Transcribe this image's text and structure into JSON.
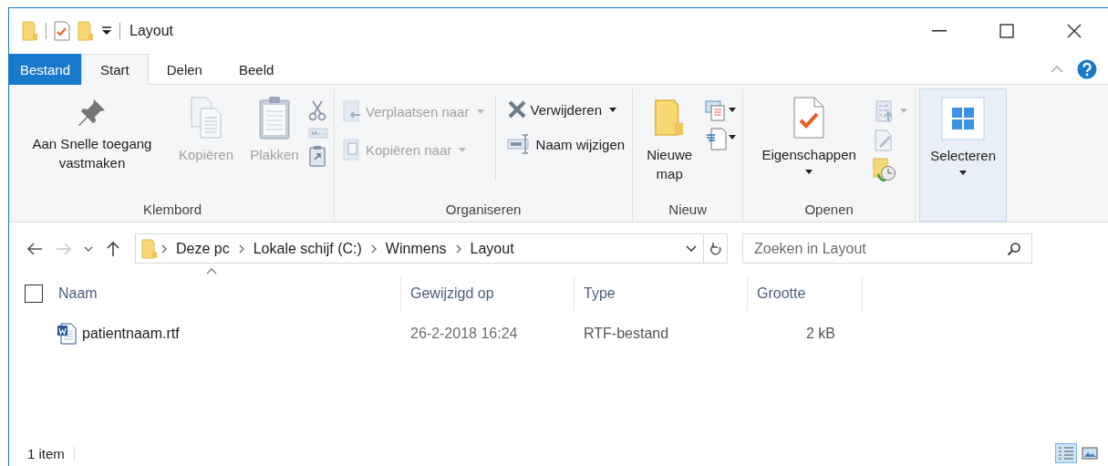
{
  "window": {
    "title": "Layout"
  },
  "ribbon_tabs": [
    {
      "label": "Bestand",
      "kind": "file",
      "selected": false
    },
    {
      "label": "Start",
      "kind": "tab",
      "selected": true
    },
    {
      "label": "Delen",
      "kind": "tab",
      "selected": false
    },
    {
      "label": "Beeld",
      "kind": "tab",
      "selected": false
    }
  ],
  "ribbon_groups": [
    {
      "label": "Klembord",
      "buttons": [
        {
          "label": "Aan Snelle toegang vastmaken",
          "disabled": false
        },
        {
          "label": "Kopiëren",
          "disabled": true
        },
        {
          "label": "Plakken",
          "disabled": true
        }
      ]
    },
    {
      "label": "Organiseren",
      "buttons": [
        {
          "label": "Verplaatsen naar",
          "disabled": true
        },
        {
          "label": "Kopiëren naar",
          "disabled": true
        },
        {
          "label": "Verwijderen",
          "disabled": false
        },
        {
          "label": "Naam wijzigen",
          "disabled": false
        }
      ]
    },
    {
      "label": "Nieuw",
      "buttons": [
        {
          "label": "Nieuwe map",
          "disabled": false
        }
      ]
    },
    {
      "label": "Openen",
      "buttons": [
        {
          "label": "Eigenschappen",
          "disabled": false
        }
      ]
    },
    {
      "buttons": [
        {
          "label": "Selecteren",
          "disabled": false
        }
      ]
    }
  ],
  "address_bar": {
    "crumbs": [
      "Deze pc",
      "Lokale schijf (C:)",
      "Winmens",
      "Layout"
    ]
  },
  "search": {
    "placeholder": "Zoeken in Layout"
  },
  "table": {
    "select_all": {
      "checked": false
    },
    "columns": [
      "Naam",
      "Gewijzigd op",
      "Type",
      "Grootte"
    ],
    "rows": [
      {
        "name": "patientnaam.rtf",
        "modified": "26-2-2018 16:24",
        "type": "RTF-bestand",
        "size": "2 kB"
      }
    ]
  },
  "status_bar": {
    "text": "1 item",
    "views": [
      {
        "kind": "details",
        "selected": true
      },
      {
        "kind": "large",
        "selected": false
      }
    ]
  }
}
